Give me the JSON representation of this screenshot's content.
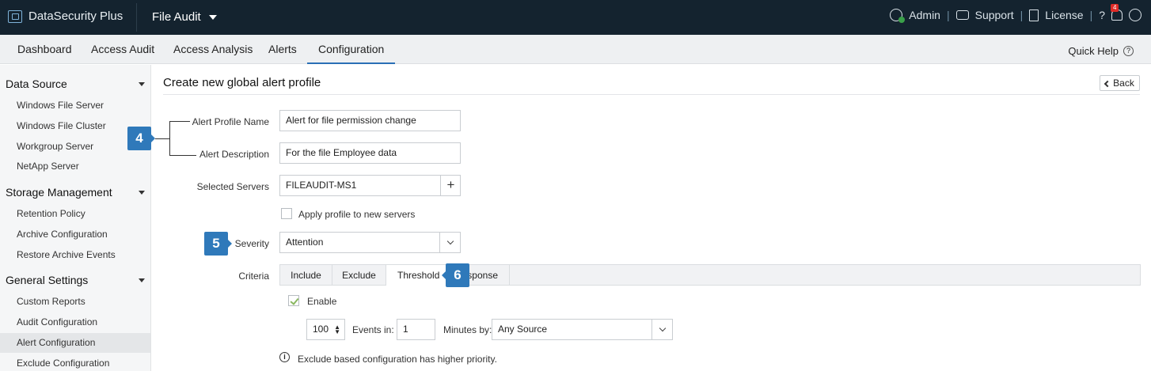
{
  "topbar": {
    "brand": "DataSecurity Plus",
    "module": "File Audit",
    "admin": "Admin",
    "support": "Support",
    "license": "License",
    "help": "?",
    "notification_count": "4"
  },
  "nav": {
    "tabs": [
      "Dashboard",
      "Access Audit",
      "Access Analysis",
      "Alerts",
      "Configuration"
    ],
    "active_tab": "Configuration",
    "quick_help": "Quick Help",
    "quick_help_icon": "?"
  },
  "sidebar": {
    "sections": [
      {
        "title": "Data Source",
        "items": [
          "Windows File Server",
          "Windows File Cluster",
          "Workgroup Server",
          "NetApp Server"
        ]
      },
      {
        "title": "Storage Management",
        "items": [
          "Retention Policy",
          "Archive Configuration",
          "Restore Archive Events"
        ]
      },
      {
        "title": "General Settings",
        "items": [
          "Custom Reports",
          "Audit Configuration",
          "Alert Configuration",
          "Exclude Configuration"
        ]
      }
    ],
    "active_item": "Alert Configuration"
  },
  "page": {
    "title": "Create new global alert profile",
    "back_label": "Back"
  },
  "form": {
    "profile_name_label": "Alert Profile Name",
    "profile_name_value": "Alert for file permission change",
    "description_label": "Alert Description",
    "description_value": "For the file Employee data",
    "servers_label": "Selected Servers",
    "servers_value": "FILEAUDIT-MS1",
    "add_server": "+",
    "apply_new_servers_label": "Apply profile to new servers",
    "severity_label": "Severity",
    "severity_value": "Attention",
    "criteria_label": "Criteria",
    "criteria_tabs": [
      "Include",
      "Exclude",
      "Threshold",
      "sponse"
    ],
    "active_criteria_tab": "Threshold",
    "enable_label": "Enable",
    "threshold_count": "100",
    "events_in_label": "Events in:",
    "events_in_value": "1",
    "minutes_by_label": "Minutes by:",
    "minutes_by_value": "Any Source",
    "note": "Exclude based configuration has higher priority.",
    "info_icon": "i"
  },
  "callouts": [
    "4",
    "5",
    "6"
  ],
  "colors": {
    "topbar_bg": "#14232f",
    "accent": "#2a6fb6",
    "callout": "#2f79ba",
    "check": "#8ab861",
    "badge": "#e02b27"
  }
}
